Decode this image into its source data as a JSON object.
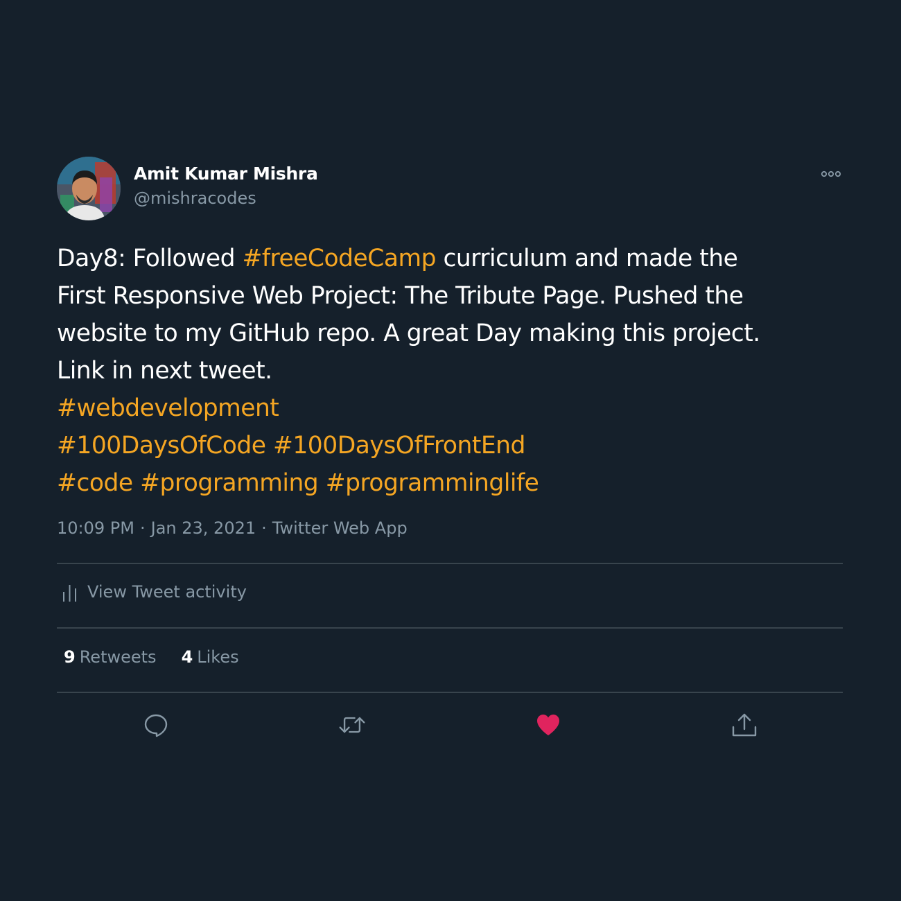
{
  "author": {
    "name": "Amit Kumar Mishra",
    "handle": "@mishracodes"
  },
  "tweet": {
    "segments": [
      {
        "text": "Day8: Followed ",
        "tag": false
      },
      {
        "text": "#freeCodeCamp",
        "tag": true
      },
      {
        "text": " curriculum and made the",
        "tag": false
      },
      {
        "text": "First Responsive Web Project: The Tribute Page. Pushed the",
        "tag": false
      },
      {
        "text": "website to my GitHub repo. A great Day making this project.",
        "tag": false
      },
      {
        "text": "Link in next tweet.",
        "tag": false
      },
      {
        "text": "#webdevelopment",
        "tag": true
      },
      {
        "text": "#100DaysOfCode",
        "tag": true
      },
      {
        "text": "#100DaysOfFrontEnd",
        "tag": true
      },
      {
        "text": "#code",
        "tag": true
      },
      {
        "text": "#programming",
        "tag": true
      },
      {
        "text": "#programminglife",
        "tag": true
      }
    ],
    "time": "10:09 PM",
    "date": "Jan 23, 2021",
    "source": "Twitter Web App",
    "separator": "·"
  },
  "activity": {
    "label": "View Tweet activity"
  },
  "stats": {
    "retweets_count": "9",
    "retweets_label": "Retweets",
    "likes_count": "4",
    "likes_label": "Likes"
  },
  "actions": [
    "reply-icon",
    "retweet-icon",
    "heart-icon",
    "share-icon"
  ],
  "colors": {
    "background": "#15202b",
    "hashtag": "#f5a623",
    "secondary_text": "#8899a6",
    "divider": "#38444d",
    "like": "#e0245e"
  }
}
